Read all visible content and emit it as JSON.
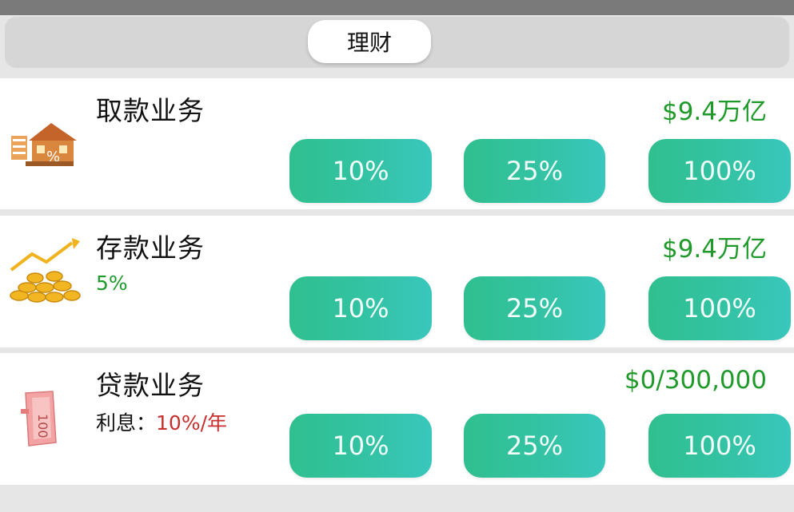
{
  "header": {
    "tab_label": "理财"
  },
  "accounts": [
    {
      "title": "取款业务",
      "amount": "$9.4万亿",
      "icon": "house-percent-icon",
      "buttons": [
        "10%",
        "25%",
        "100%"
      ]
    },
    {
      "title": "存款业务",
      "rate": "5%",
      "amount": "$9.4万亿",
      "icon": "coins-growth-icon",
      "buttons": [
        "10%",
        "25%",
        "100%"
      ]
    },
    {
      "title": "贷款业务",
      "interest_label": "利息：",
      "interest_rate": "10%/年",
      "amount": "$0/300,000",
      "icon": "banknote-icon",
      "buttons": [
        "10%",
        "25%",
        "100%"
      ]
    }
  ],
  "colors": {
    "accent_green": "#1f9a2a",
    "button_teal": "#34c3a6",
    "rate_red": "#c8302e"
  }
}
